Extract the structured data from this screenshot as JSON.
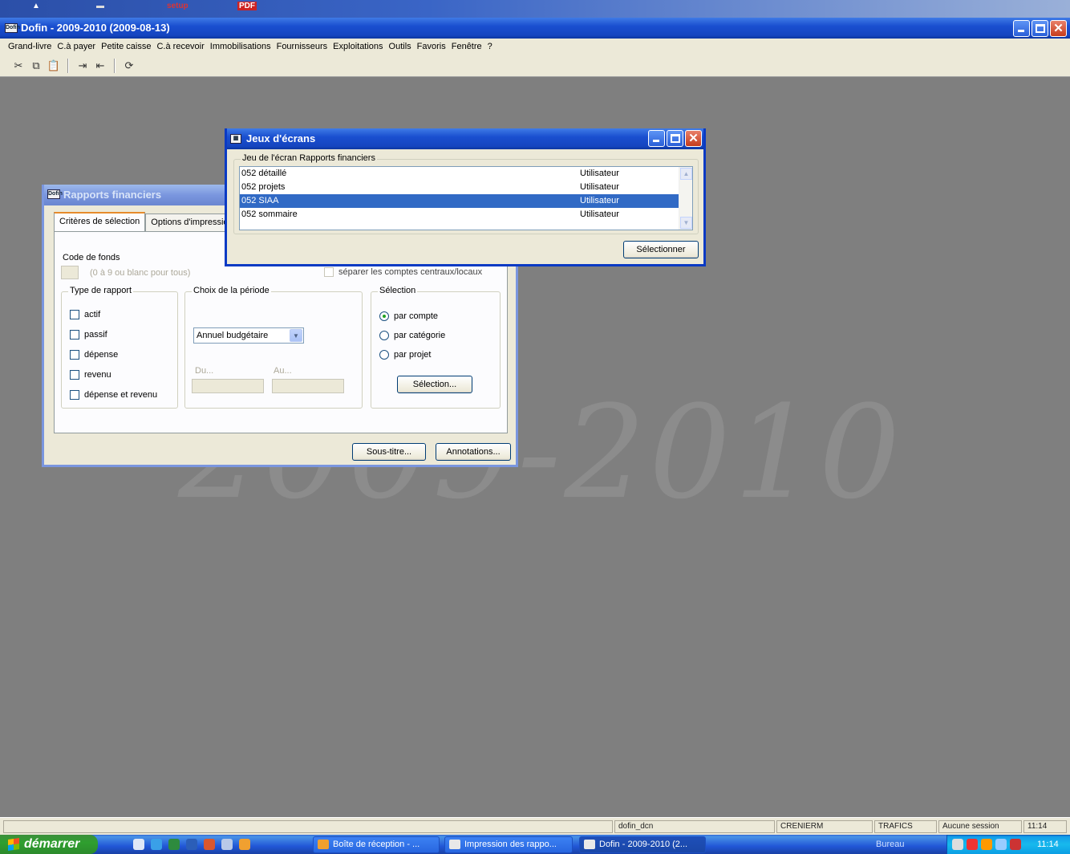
{
  "desktop_icons": [
    "setup",
    "PDF"
  ],
  "main_window": {
    "title": "Dofin - 2009-2010 (2009-08-13)",
    "app_icon": "dofin-icon",
    "menu": [
      "Grand-livre",
      "C.à payer",
      "Petite caisse",
      "C.à recevoir",
      "Immobilisations",
      "Fournisseurs",
      "Exploitations",
      "Outils",
      "Favoris",
      "Fenêtre",
      "?"
    ],
    "toolbar_icons": [
      "cut-icon",
      "copy-icon",
      "paste-icon",
      "indent-icon",
      "outdent-icon",
      "refresh-icon"
    ],
    "watermark": "2009-2010"
  },
  "rapports": {
    "title": "Rapports financiers",
    "tabs": [
      "Critères de sélection",
      "Options d'impression"
    ],
    "code_fonds_label": "Code de fonds",
    "code_fonds_hint": "(0 à 9 ou blanc pour tous)",
    "separer_label": "séparer les comptes centraux/locaux",
    "type_rapport": {
      "title": "Type de rapport",
      "options": [
        "actif",
        "passif",
        "dépense",
        "revenu",
        "dépense et revenu"
      ]
    },
    "periode": {
      "title": "Choix de la période",
      "selected": "Annuel budgétaire",
      "du_label": "Du...",
      "au_label": "Au..."
    },
    "selection": {
      "title": "Sélection",
      "options": [
        "par compte",
        "par catégorie",
        "par projet"
      ],
      "selected_index": 0,
      "button": "Sélection..."
    },
    "buttons": {
      "sous_titre": "Sous-titre...",
      "annotations": "Annotations..."
    }
  },
  "jeux": {
    "title": "Jeux d'écrans",
    "group_title": "Jeu de l'écran Rapports financiers",
    "rows": [
      {
        "name": "052 détaillé",
        "type": "Utilisateur"
      },
      {
        "name": "052 projets",
        "type": "Utilisateur"
      },
      {
        "name": "052 SIAA",
        "type": "Utilisateur"
      },
      {
        "name": "052 sommaire",
        "type": "Utilisateur"
      }
    ],
    "selected_index": 2,
    "button": "Sélectionner"
  },
  "statusbar": [
    "dofin_dcn",
    "CRENIERM",
    "TRAFICS",
    "Aucune session",
    "11:14"
  ],
  "taskbar": {
    "start": "démarrer",
    "tasks": [
      "Boîte de réception - ...",
      "Impression des rappo...",
      "Dofin - 2009-2010 (2..."
    ],
    "bureau": "Bureau",
    "clock": "11:14"
  },
  "colors": {
    "title_active": "#1a4fd0",
    "title_inactive": "#7a96df",
    "selection": "#316ac5",
    "dialog_bg": "#ece9d8",
    "desktop": "#7f7f7f"
  }
}
